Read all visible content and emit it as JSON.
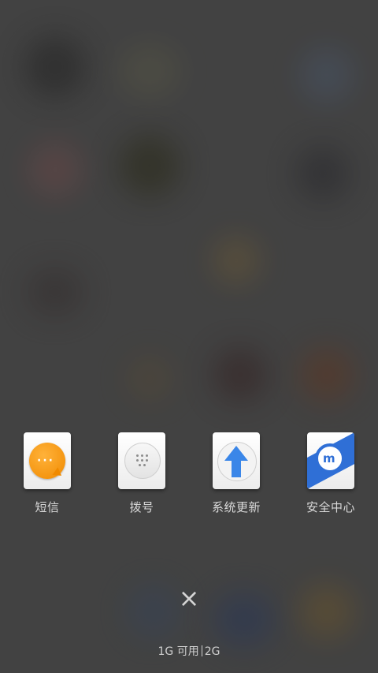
{
  "recent_apps": [
    {
      "label": "短信",
      "icon": "sms-icon"
    },
    {
      "label": "拨号",
      "icon": "dialer-icon"
    },
    {
      "label": "系统更新",
      "icon": "system-update-icon"
    },
    {
      "label": "安全中心",
      "icon": "security-center-icon"
    }
  ],
  "close": {
    "symbol": "×"
  },
  "memory": {
    "available": "1G 可用",
    "total": "2G"
  },
  "colors": {
    "sms": "#f08a00",
    "update": "#3a86e8",
    "security": "#2f6fd6"
  }
}
